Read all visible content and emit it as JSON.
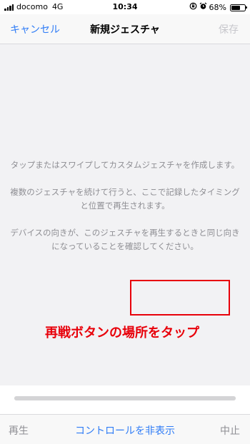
{
  "status_bar": {
    "carrier": "docomo",
    "network": "4G",
    "time": "10:34",
    "battery": "68%",
    "battery_level": 0.68,
    "icons": [
      "signal-bars-icon",
      "orientation-lock-icon",
      "alarm-icon",
      "battery-icon"
    ]
  },
  "nav": {
    "cancel_label": "キャンセル",
    "title": "新規ジェスチャ",
    "save_label": "保存"
  },
  "instructions": {
    "p1": "タップまたはスワイプしてカスタムジェスチャを作成します。",
    "p2": "複数のジェスチャを続けて行うと、ここで記録したタイミングと位置で再生されます。",
    "p3": "デバイスの向きが、このジェスチャを再生するときと同じ向きになっていることを確認してください。"
  },
  "annotation": {
    "caption": "再戦ボタンの場所をタップ",
    "color": "#e8000a"
  },
  "progress": {
    "value": 1.0
  },
  "toolbar": {
    "play_label": "再生",
    "hide_controls_label": "コントロールを非表示",
    "stop_label": "中止"
  },
  "colors": {
    "accent": "#2f7cf6",
    "disabled": "#c7c7cc",
    "secondary_text": "#8e8e93"
  }
}
